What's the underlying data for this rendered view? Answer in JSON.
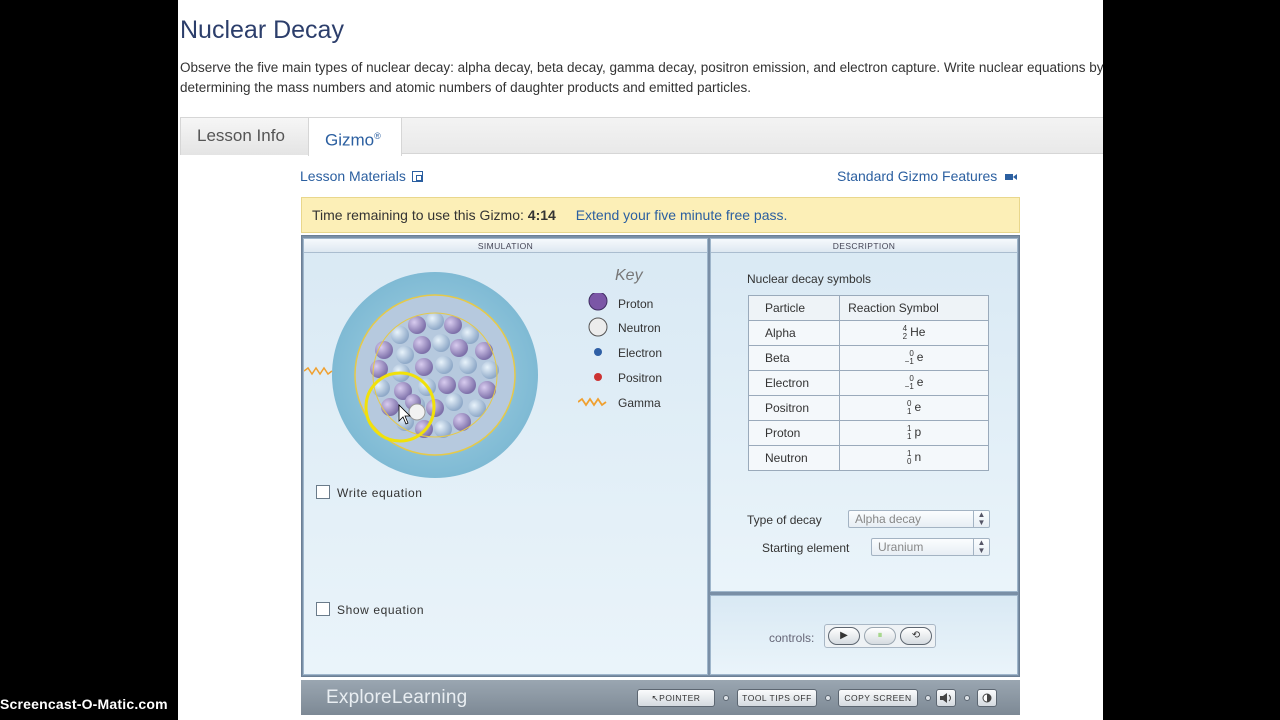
{
  "page": {
    "title": "Nuclear Decay",
    "description": "Observe the five main types of nuclear decay: alpha decay, beta decay, gamma decay, positron emission, and electron capture. Write nuclear equations by determining the mass numbers and atomic numbers of daughter products and emitted particles."
  },
  "tabs": [
    {
      "label": "Lesson Info"
    },
    {
      "label": "Gizmo",
      "mark": "®"
    }
  ],
  "links": {
    "lesson_materials": "Lesson Materials",
    "standard_features": "Standard Gizmo Features"
  },
  "banner": {
    "prefix": "Time remaining to use this Gizmo:",
    "time": "4:14",
    "extend": "Extend your five minute free pass."
  },
  "simulation": {
    "header": "SIMULATION",
    "key_title": "Key",
    "key_items": [
      {
        "label": "Proton",
        "color": "#7b56a6"
      },
      {
        "label": "Neutron",
        "color": "#e9e9e9"
      },
      {
        "label": "Electron",
        "color": "#2f5fa5"
      },
      {
        "label": "Positron",
        "color": "#cc3333"
      },
      {
        "label": "Gamma",
        "color": "#f0a030"
      }
    ],
    "write_equation": "Write equation",
    "show_equation": "Show equation"
  },
  "description": {
    "header": "DESCRIPTION",
    "title": "Nuclear decay symbols",
    "table_headers": [
      "Particle",
      "Reaction Symbol"
    ],
    "rows": [
      {
        "particle": "Alpha",
        "mass": "4",
        "atomic": "2",
        "symbol": "He"
      },
      {
        "particle": "Beta",
        "mass": "0",
        "atomic": "−1",
        "symbol": "e"
      },
      {
        "particle": "Electron",
        "mass": "0",
        "atomic": "−1",
        "symbol": "e"
      },
      {
        "particle": "Positron",
        "mass": "0",
        "atomic": "1",
        "symbol": "e"
      },
      {
        "particle": "Proton",
        "mass": "1",
        "atomic": "1",
        "symbol": "p"
      },
      {
        "particle": "Neutron",
        "mass": "1",
        "atomic": "0",
        "symbol": "n"
      }
    ],
    "type_label": "Type of decay",
    "type_value": "Alpha decay",
    "element_label": "Starting element",
    "element_value": "Uranium"
  },
  "controls": {
    "label": "controls:",
    "play": "▶",
    "pause": "⏸",
    "reset": "⟲"
  },
  "bottom_bar": {
    "brand": "ExploreLearning",
    "pointer": "↖POINTER",
    "tooltips": "TOOL TIPS OFF",
    "copy": "COPY SCREEN"
  },
  "watermark": "Screencast-O-Matic.com"
}
